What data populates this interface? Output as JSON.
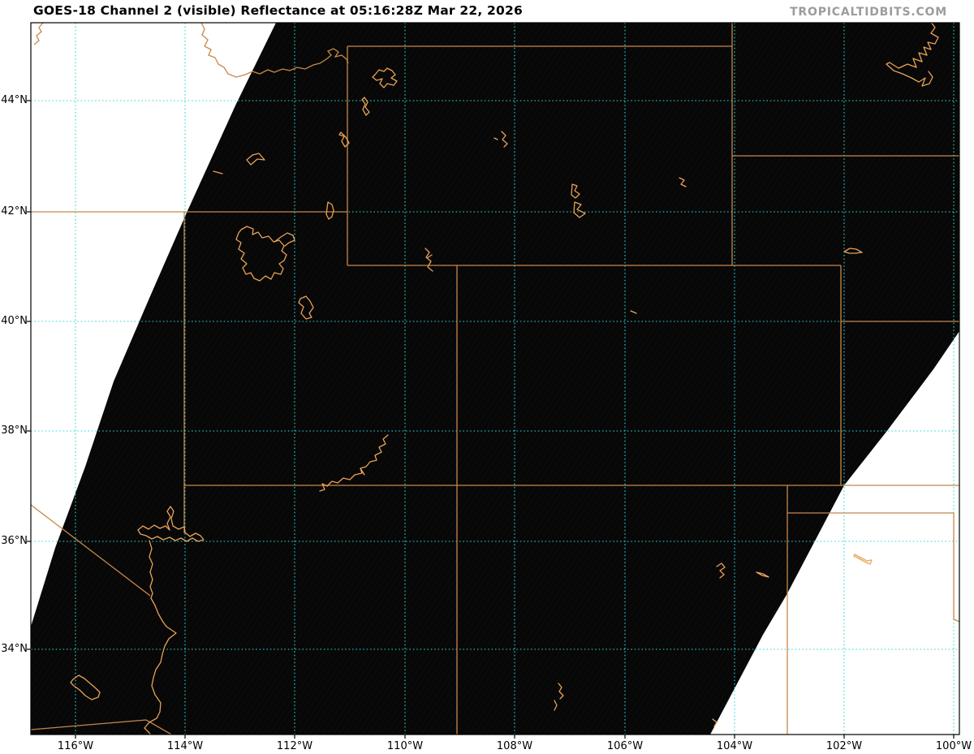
{
  "header": {
    "title": "GOES-18 Channel 2 (visible) Reflectance at 05:16:28Z Mar 22, 2026",
    "watermark": "TROPICALTIDBITS.COM"
  },
  "image_meta": {
    "satellite": "GOES-18",
    "channel": "Channel 2 (visible)",
    "product": "Reflectance",
    "valid_time": "05:16:28Z Mar 22, 2026"
  },
  "axes": {
    "lat_labels": [
      "44°N",
      "42°N",
      "40°N",
      "38°N",
      "36°N",
      "34°N"
    ],
    "lon_labels": [
      "116°W",
      "114°W",
      "112°W",
      "110°W",
      "108°W",
      "106°W",
      "104°W",
      "102°W",
      "100°W"
    ]
  },
  "colors": {
    "background": "#ffffff",
    "scan_area_fill": "#070707",
    "gridline_cyan": "#2ed9d6",
    "state_border_orange": "#c8874b",
    "water_orange": "#e9a257",
    "frame_black": "#000000",
    "title_color": "#000000",
    "watermark_gray": "#9c9c9c"
  }
}
